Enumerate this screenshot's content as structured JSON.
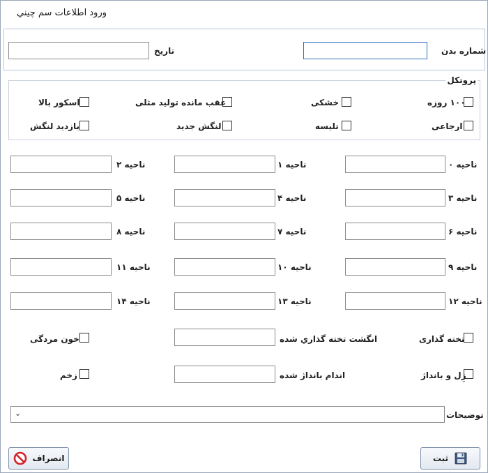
{
  "window": {
    "title": "ورود اطلاعات سم چيني"
  },
  "header": {
    "body_number_label": "شماره بدن",
    "body_number_value": "",
    "date_label": "تاريخ",
    "date_value": ""
  },
  "protocol": {
    "title": "پروتکل",
    "options": [
      {
        "label": "۱۰۰ روزه",
        "checked": false
      },
      {
        "label": "خشکی",
        "checked": false
      },
      {
        "label": "عقب مانده توليد مثلی",
        "checked": false
      },
      {
        "label": "اسکور بالا",
        "checked": false
      },
      {
        "label": "ارجاعی",
        "checked": false
      },
      {
        "label": "تليسه",
        "checked": false
      },
      {
        "label": "لنگش جديد",
        "checked": false
      },
      {
        "label": "بازديد لنگش",
        "checked": false
      }
    ]
  },
  "zones": [
    {
      "label": "ناحيه ۰",
      "value": ""
    },
    {
      "label": "ناحيه ۱",
      "value": ""
    },
    {
      "label": "ناحيه ۲",
      "value": ""
    },
    {
      "label": "ناحيه ۳",
      "value": ""
    },
    {
      "label": "ناحيه ۴",
      "value": ""
    },
    {
      "label": "ناحيه ۵",
      "value": ""
    },
    {
      "label": "ناحيه ۶",
      "value": ""
    },
    {
      "label": "ناحيه ۷",
      "value": ""
    },
    {
      "label": "ناحيه ۸",
      "value": ""
    },
    {
      "label": "ناحيه ۹",
      "value": ""
    },
    {
      "label": "ناحيه ۱۰",
      "value": ""
    },
    {
      "label": "ناحيه ۱۱",
      "value": ""
    },
    {
      "label": "ناحيه ۱۲",
      "value": ""
    },
    {
      "label": "ناحيه ۱۳",
      "value": ""
    },
    {
      "label": "ناحيه ۱۴",
      "value": ""
    }
  ],
  "extras": {
    "board_label": "تخته گذاری",
    "board_checked": false,
    "board_finger_label": "انگشت تخته گذاري شده",
    "board_finger_value": "",
    "blood_label": "خون مردگی",
    "blood_checked": false,
    "bandage_label": "زِل و بانداژ",
    "bandage_checked": false,
    "bandaged_limb_label": "اندام بانداژ شده",
    "bandaged_limb_value": "",
    "wound_label": "زخم",
    "wound_checked": false
  },
  "notes": {
    "label": "توضيحات",
    "value": ""
  },
  "buttons": {
    "save_label": "ثبت",
    "cancel_label": "انصراف"
  }
}
